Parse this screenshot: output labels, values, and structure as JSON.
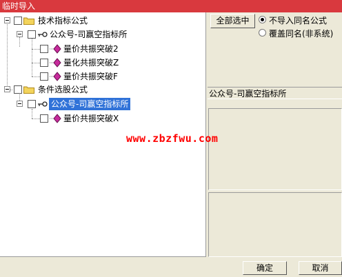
{
  "window": {
    "title": "临时导入"
  },
  "tree": {
    "groups": [
      {
        "label": "技术指标公式",
        "child": {
          "label": "公众号-司赢空指标所",
          "items": [
            "量价共振突破2",
            "量化共振突破Z",
            "量价共振突破F"
          ]
        }
      },
      {
        "label": "条件选股公式",
        "child": {
          "label": "公众号-司赢空指标所",
          "items": [
            "量价共振突破X"
          ]
        }
      }
    ]
  },
  "options": {
    "select_all_label": "全部选中",
    "radio_skip_label": "不导入同名公式",
    "radio_overwrite_label": "覆盖同名(非系统)",
    "selected_radio": "skip"
  },
  "info": {
    "selected_name": "公众号-司赢空指标所"
  },
  "watermark": "www.zbzfwu.com",
  "footer": {
    "ok_label": "确定",
    "cancel_label": "取消"
  },
  "colors": {
    "titlebar": "#d9393e",
    "selection": "#3072d8",
    "watermark": "#ff0000"
  }
}
